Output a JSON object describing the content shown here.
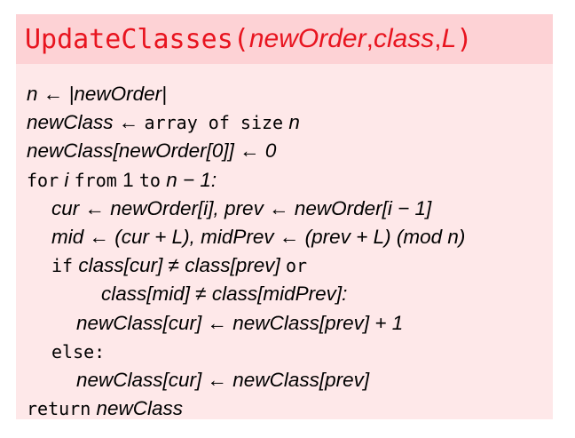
{
  "header": {
    "func_name": "UpdateClasses",
    "open_paren": "(",
    "arg1": "newOrder",
    "comma1": ", ",
    "arg2": "class",
    "comma2": ", ",
    "arg3": "L",
    "close_paren": ")"
  },
  "lines": [
    {
      "text": "n ← |newOrder|"
    },
    {
      "pre": "newClass ← ",
      "kw": "array of size",
      "post": " n"
    },
    {
      "text": "newClass[newOrder[0]] ← 0"
    },
    {
      "kw1": "for",
      "mid1": " i ",
      "kw2": "from",
      "mid2": " 1 ",
      "kw3": "to",
      "post": " n − 1:"
    },
    {
      "text": "cur ← newOrder[i], prev ← newOrder[i − 1]"
    },
    {
      "text": "mid ← (cur + L), midPrev ← (prev + L)  (mod n)"
    },
    {
      "kw1": "if",
      "mid": " class[cur] ≠ class[prev] ",
      "kw2": "or"
    },
    {
      "text": "class[mid] ≠ class[midPrev]:"
    },
    {
      "text": "newClass[cur] ← newClass[prev] + 1"
    },
    {
      "kw": "else:"
    },
    {
      "text": "newClass[cur] ← newClass[prev]"
    },
    {
      "kw": "return",
      "post": " newClass"
    }
  ]
}
